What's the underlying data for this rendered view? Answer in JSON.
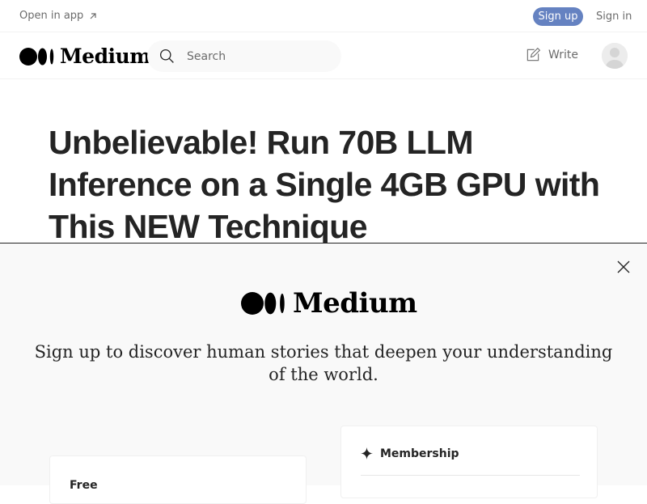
{
  "topbar": {
    "open_in_app": "Open in app",
    "sign_up": "Sign up",
    "sign_in": "Sign in"
  },
  "header": {
    "logo_text": "Medium",
    "search_placeholder": "Search",
    "write_label": "Write"
  },
  "article": {
    "title": "Unbelievable! Run 70B LLM Inference on a Single 4GB GPU with This NEW Technique"
  },
  "signup_modal": {
    "logo_text": "Medium",
    "tagline": "Sign up to discover human stories that deepen your understanding of the world.",
    "free_plan_label": "Free",
    "membership_label": "Membership"
  },
  "colors": {
    "accent_signup": "#6582c1",
    "text_primary": "#242424",
    "text_muted": "#6b6b6b",
    "modal_bg": "#f9f9f9"
  },
  "icons": [
    "arrow-up-right-icon",
    "medium-logo-icon",
    "search-icon",
    "write-icon",
    "avatar-icon",
    "close-icon",
    "sparkle-icon"
  ]
}
